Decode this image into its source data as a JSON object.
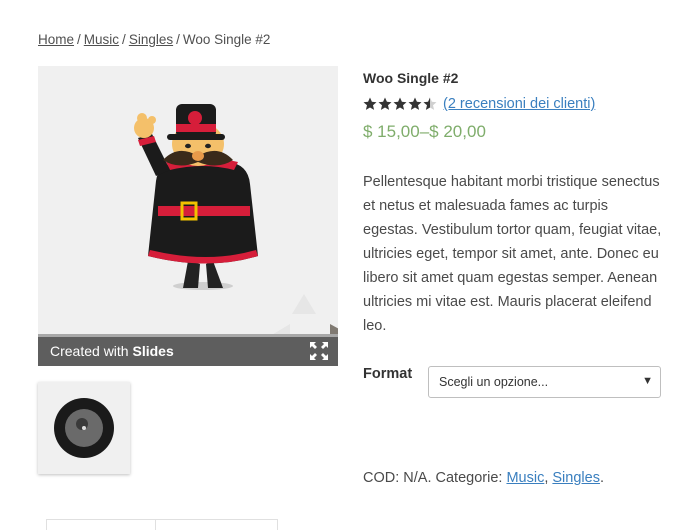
{
  "breadcrumb": {
    "home": "Home",
    "music": "Music",
    "singles": "Singles",
    "current": "Woo Single #2",
    "separator": "/"
  },
  "gallery": {
    "caption_prefix": "Created with",
    "caption_brand": "Slides"
  },
  "product": {
    "title": "Woo Single #2",
    "rating_value": 4.5,
    "rating_max": 5,
    "review_link": "(2 recensioni dei clienti)",
    "price": "$ 15,00–$ 20,00",
    "description": "Pellentesque habitant morbi tristique senectus et netus et malesuada fames ac turpis egestas. Vestibulum tortor quam, feugiat vitae, ultricies eget, tempor sit amet, ante. Donec eu libero sit amet quam egestas semper. Aenean ultricies mi vitae est. Mauris placerat eleifend leo."
  },
  "variations": {
    "label": "Format",
    "select_value": "Scegli un opzione..."
  },
  "meta": {
    "sku": "COD: N/A.",
    "categories_label": "Categorie:",
    "category_music": "Music",
    "category_singles": "Singles",
    "comma": ",",
    "period": "."
  },
  "colors": {
    "price": "#7fad6b",
    "link": "#3a7fbf",
    "caption_bar": "#5e5e5e",
    "gallery_bg": "#f0f0f0"
  }
}
